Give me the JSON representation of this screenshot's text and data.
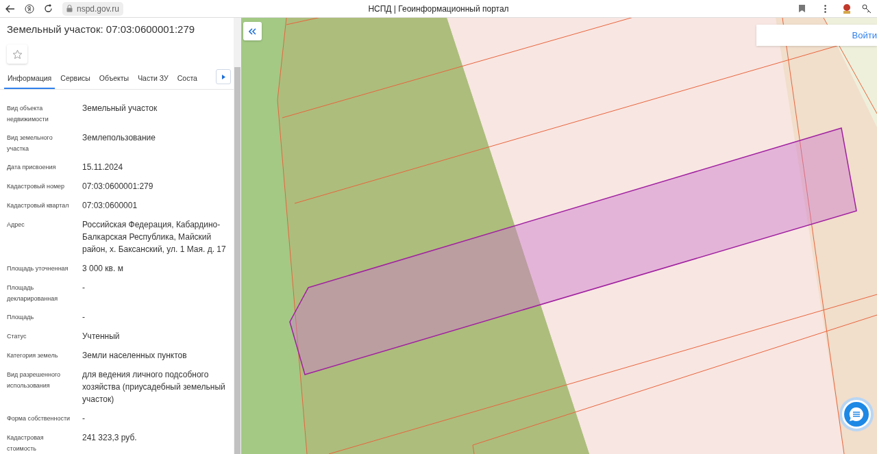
{
  "browser": {
    "url": "nspd.gov.ru",
    "title": "НСПД | Геоинформационный портал"
  },
  "panel": {
    "title": "Земельный участок: 07:03:0600001:279",
    "favorite": false,
    "tabs": [
      {
        "label": "Информация",
        "selected": true
      },
      {
        "label": "Сервисы",
        "selected": false
      },
      {
        "label": "Объекты",
        "selected": false
      },
      {
        "label": "Части ЗУ",
        "selected": false
      },
      {
        "label": "Соста",
        "selected": false
      }
    ],
    "fields": [
      {
        "label": "Вид объекта недвижимости",
        "value": "Земельный участок"
      },
      {
        "label": "Вид земельного участка",
        "value": "Землепользование"
      },
      {
        "label": "Дата присвоения",
        "value": "15.11.2024"
      },
      {
        "label": "Кадастровый номер",
        "value": "07:03:0600001:279"
      },
      {
        "label": "Кадастровый квартал",
        "value": "07:03:0600001"
      },
      {
        "label": "Адрес",
        "value": "Российская Федерация, Кабардино-Балкарская Республика, Майский район, х. Баксанский, ул. 1 Мая. д. 17"
      },
      {
        "label": "Площадь уточненная",
        "value": "3 000 кв. м"
      },
      {
        "label": "Площадь декларированная",
        "value": "-"
      },
      {
        "label": "Площадь",
        "value": "-"
      },
      {
        "label": "Статус",
        "value": "Учтенный"
      },
      {
        "label": "Категория земель",
        "value": "Земли населенных пунктов"
      },
      {
        "label": "Вид разрешенного использования",
        "value": "для ведения личного подсобного хозяйства (приусадебный земельный участок)"
      },
      {
        "label": "Форма собственности",
        "value": "-"
      },
      {
        "label": "Кадастровая стоимость",
        "value": "241 323,3 руб."
      }
    ]
  },
  "map": {
    "login": "Войти"
  }
}
